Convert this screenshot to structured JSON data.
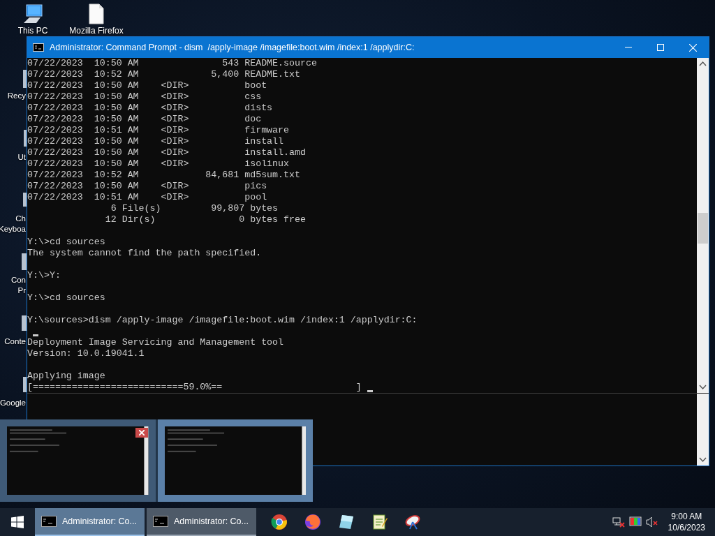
{
  "desktop_icons": [
    {
      "kind": "pc",
      "lines": [
        "This PC"
      ]
    },
    {
      "kind": "file",
      "lines": [
        "Mozilla Firefox"
      ]
    },
    {
      "kind": "partial",
      "lines": [
        "Recy"
      ]
    },
    {
      "kind": "partial",
      "lines": [
        "Ut"
      ]
    },
    {
      "kind": "partial",
      "lines": [
        "Ch",
        "Keyboa"
      ]
    },
    {
      "kind": "partial",
      "lines": [
        "Con",
        "Pr"
      ]
    },
    {
      "kind": "partial",
      "lines": [
        "Conte"
      ]
    },
    {
      "kind": "partial",
      "lines": [
        "Google"
      ]
    }
  ],
  "window": {
    "title": "Administrator: Command Prompt - dism  /apply-image /imagefile:boot.wim /index:1 /applydir:C:",
    "console": [
      {
        "kind": "text",
        "text": "07/22/2023  10:50 AM               543 README.source"
      },
      {
        "kind": "text",
        "text": "07/22/2023  10:52 AM             5,400 README.txt"
      },
      {
        "kind": "text",
        "text": "07/22/2023  10:50 AM    <DIR>          boot"
      },
      {
        "kind": "text",
        "text": "07/22/2023  10:50 AM    <DIR>          css"
      },
      {
        "kind": "text",
        "text": "07/22/2023  10:50 AM    <DIR>          dists"
      },
      {
        "kind": "text",
        "text": "07/22/2023  10:50 AM    <DIR>          doc"
      },
      {
        "kind": "text",
        "text": "07/22/2023  10:51 AM    <DIR>          firmware"
      },
      {
        "kind": "text",
        "text": "07/22/2023  10:50 AM    <DIR>          install"
      },
      {
        "kind": "text",
        "text": "07/22/2023  10:50 AM    <DIR>          install.amd"
      },
      {
        "kind": "text",
        "text": "07/22/2023  10:50 AM    <DIR>          isolinux"
      },
      {
        "kind": "text",
        "text": "07/22/2023  10:52 AM            84,681 md5sum.txt"
      },
      {
        "kind": "text",
        "text": "07/22/2023  10:50 AM    <DIR>          pics"
      },
      {
        "kind": "text",
        "text": "07/22/2023  10:51 AM    <DIR>          pool"
      },
      {
        "kind": "text",
        "text": "               6 File(s)         99,807 bytes"
      },
      {
        "kind": "text",
        "text": "              12 Dir(s)               0 bytes free"
      },
      {
        "kind": "blank"
      },
      {
        "kind": "text",
        "text": "Y:\\>cd sources"
      },
      {
        "kind": "text",
        "text": "The system cannot find the path specified."
      },
      {
        "kind": "blank"
      },
      {
        "kind": "text",
        "text": "Y:\\>Y:"
      },
      {
        "kind": "blank"
      },
      {
        "kind": "text",
        "text": "Y:\\>cd sources"
      },
      {
        "kind": "blank"
      },
      {
        "kind": "text",
        "text": "Y:\\sources>dism /apply-image /imagefile:boot.wim /index:1 /applydir:C:"
      },
      {
        "kind": "cursor"
      },
      {
        "kind": "text",
        "text": "Deployment Image Servicing and Management tool"
      },
      {
        "kind": "text",
        "text": "Version: 10.0.19041.1"
      },
      {
        "kind": "blank"
      },
      {
        "kind": "text",
        "text": "Applying image"
      },
      {
        "kind": "progress",
        "text": "[===========================59.0%==                        ]"
      }
    ]
  },
  "previews": [
    {
      "selected": false,
      "close_button": true
    },
    {
      "selected": true,
      "close_button": false
    }
  ],
  "taskbar": {
    "tasks": [
      {
        "label": "Administrator: Co...",
        "selected": true
      },
      {
        "label": "Administrator: Co...",
        "selected": false
      }
    ],
    "pinned_apps": [
      {
        "kind": "ring"
      },
      {
        "kind": "fox"
      },
      {
        "kind": "glass"
      },
      {
        "kind": "notepad"
      },
      {
        "kind": "dish"
      }
    ],
    "tray": {
      "time": "9:00 AM",
      "date": "10/6/2023"
    }
  }
}
